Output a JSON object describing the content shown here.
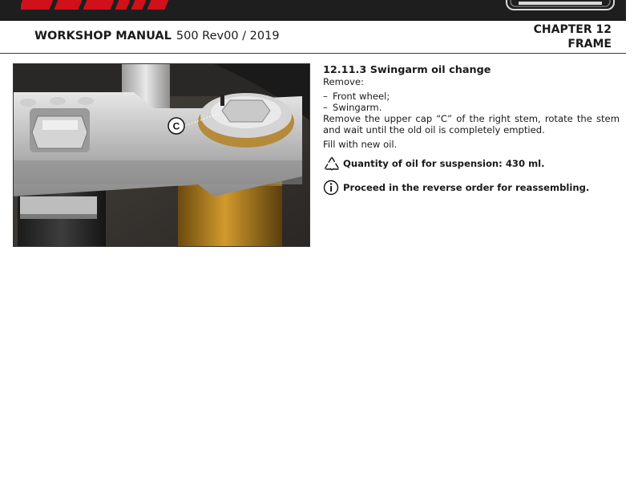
{
  "header": {
    "manual_title": "WORKSHOP MANUAL",
    "manual_rev": "500 Rev00 / 2019",
    "chapter": "CHAPTER 12",
    "chapter_name": "FRAME"
  },
  "logos": {
    "left": "FANTIC",
    "right": "CABALLERO"
  },
  "photo": {
    "callout_label": "C"
  },
  "section": {
    "title": "12.11.3  Swingarm oil change",
    "remove_label": "Remove:",
    "bullets": [
      "Front wheel;",
      "Swingarm."
    ],
    "instruction": "Remove the upper cap “C” of the right stem, rotate the stem and wait until the old oil is completely emptied.",
    "fill": "Fill with new oil.",
    "note_oil": "Quantity of oil for suspension: 430 ml.",
    "note_info": "Proceed in the reverse order for reassembling."
  },
  "colors": {
    "brand_red": "#d0101a",
    "banner": "#1e1e1e"
  },
  "icons": {
    "oil_note": "recycle-triangle-icon",
    "info_note": "info-circle-icon"
  }
}
